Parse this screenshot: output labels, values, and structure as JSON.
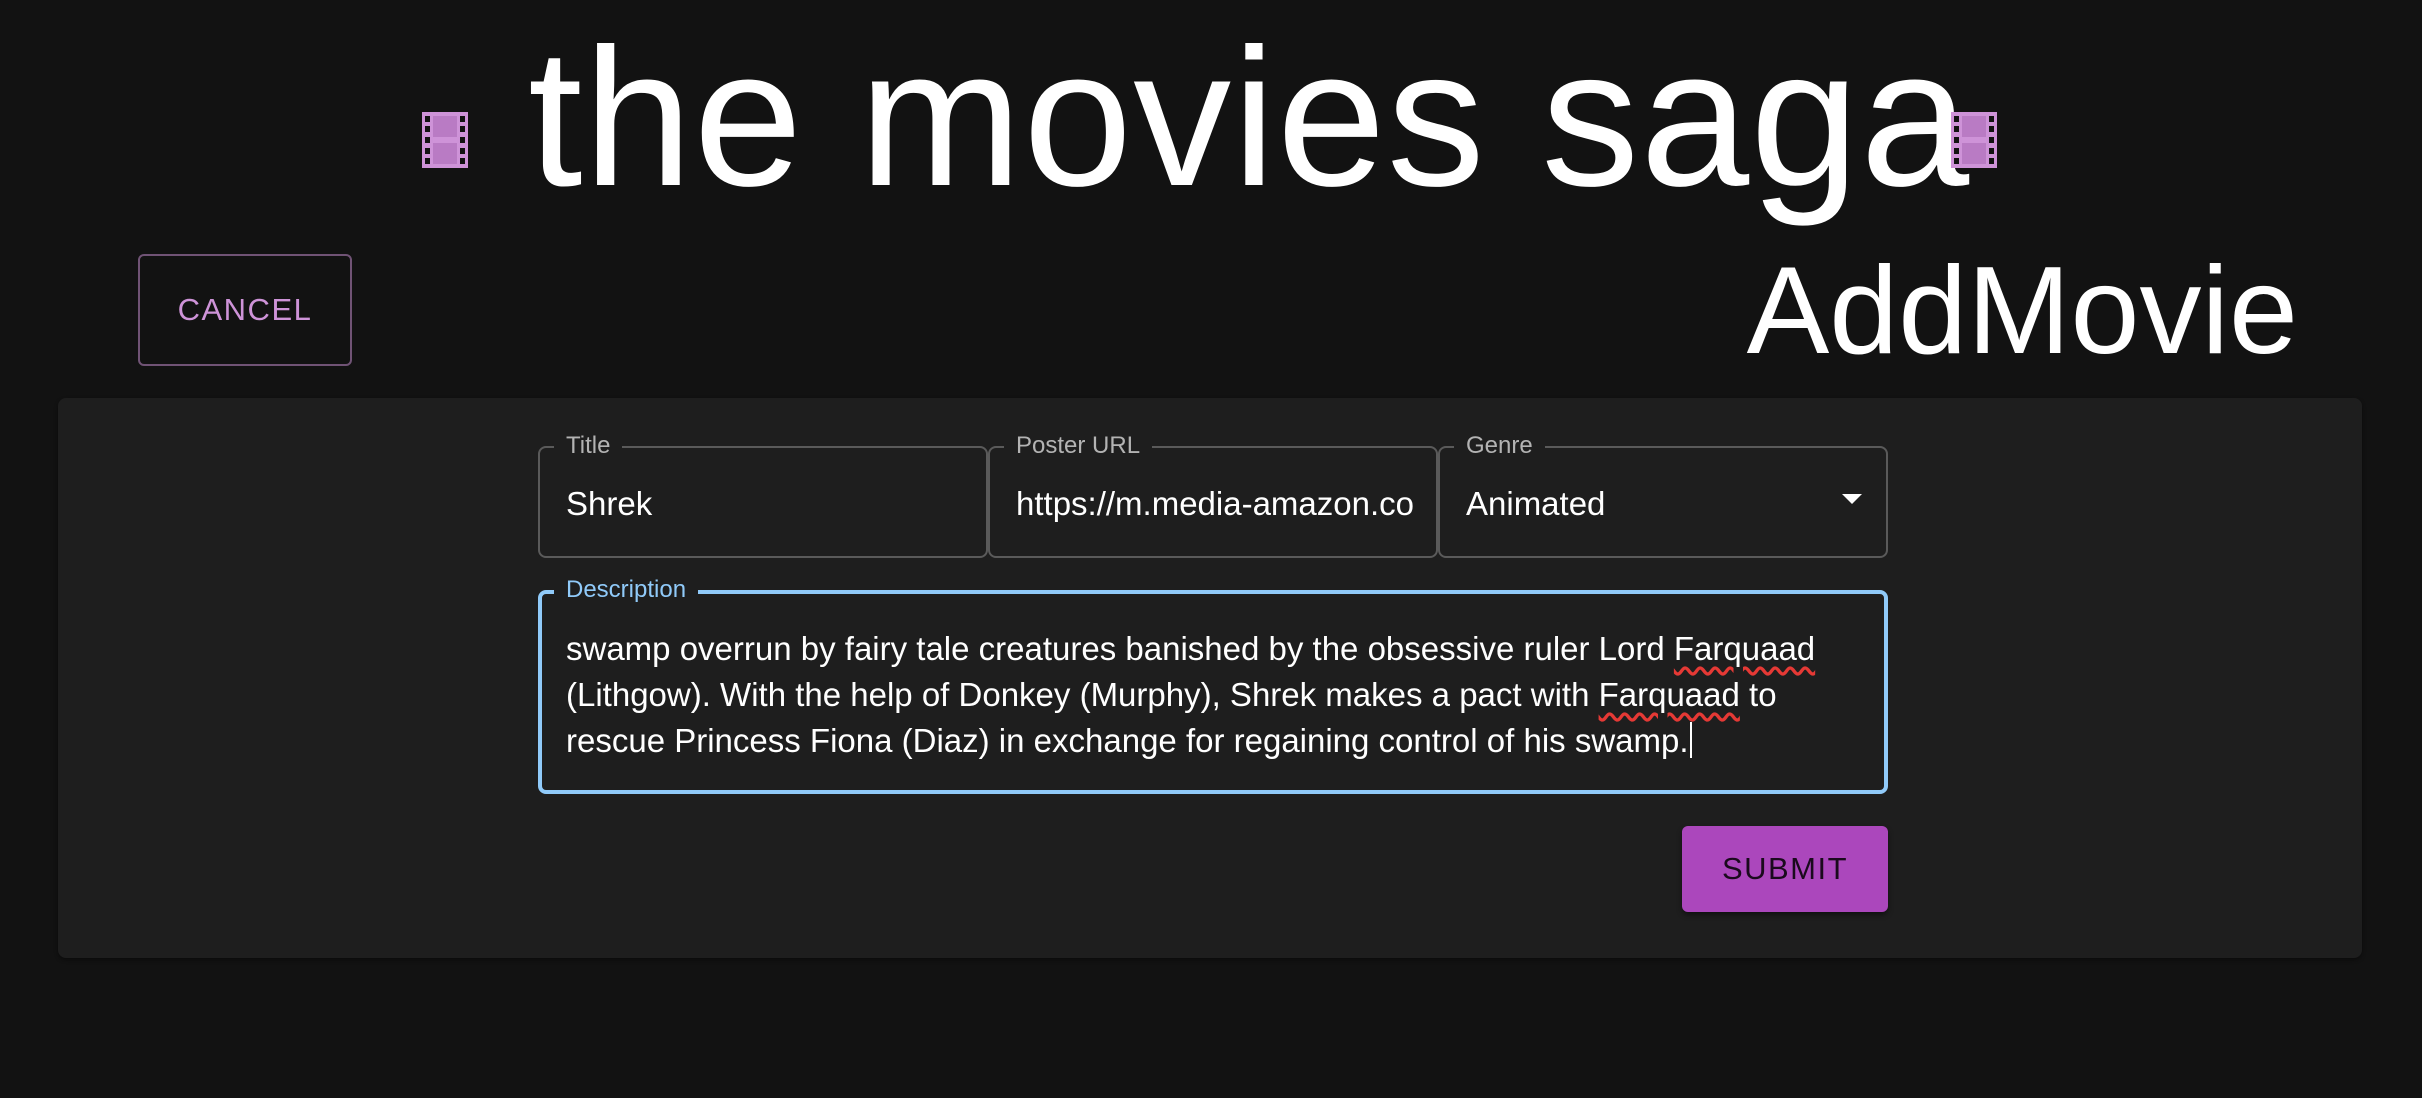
{
  "header": {
    "app_title": "the movies saga",
    "left_icon": "film-icon",
    "right_icon": "film-icon",
    "icon_color": "#ce93d8"
  },
  "actions": {
    "cancel_label": "CANCEL",
    "submit_label": "SUBMIT"
  },
  "page": {
    "title": "AddMovie"
  },
  "form": {
    "title": {
      "label": "Title",
      "value": "Shrek"
    },
    "poster_url": {
      "label": "Poster URL",
      "value": "https://m.media-amazon.co"
    },
    "genre": {
      "label": "Genre",
      "value": "Animated"
    },
    "description": {
      "label": "Description",
      "segments": [
        "swamp overrun by fairy tale creatures banished by the obsessive ruler Lord ",
        "Farquaad",
        " (Lithgow). With the help of Donkey (Murphy), Shrek makes a pact with ",
        "Farquaad",
        " to rescue Princess Fiona (Diaz) in exchange for regaining control of his swamp."
      ]
    }
  },
  "colors": {
    "background": "#121212",
    "paper": "#1e1e1e",
    "accent": "#ce93d8",
    "submit": "#ab47bc",
    "focus": "#90caf9"
  }
}
